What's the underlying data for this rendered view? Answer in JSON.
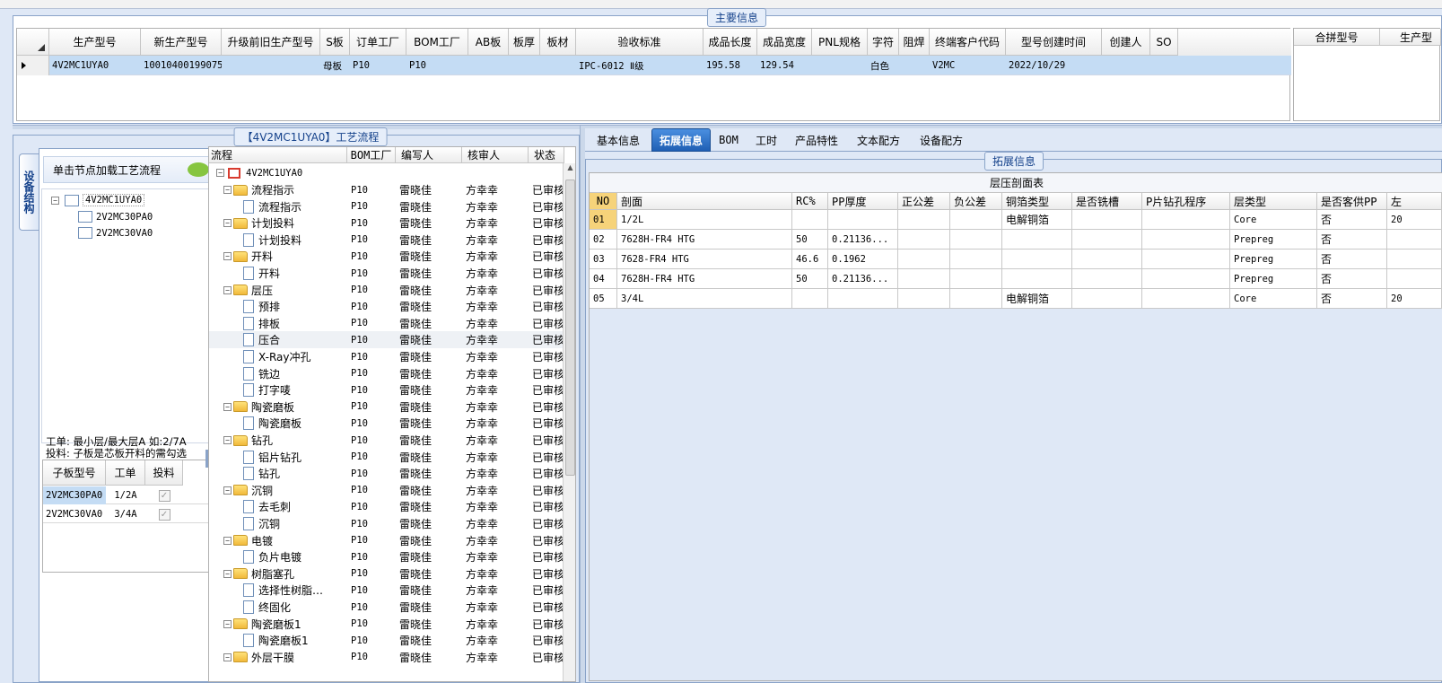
{
  "main_info": {
    "legend": "主要信息",
    "columns": [
      "生产型号",
      "新生产型号",
      "升级前旧生产型号",
      "S板",
      "订单工厂",
      "BOM工厂",
      "AB板",
      "板厚",
      "板材",
      "验收标准",
      "成品长度",
      "成品宽度",
      "PNL规格",
      "字符",
      "阻焊",
      "终端客户代码",
      "型号创建时间",
      "创建人",
      "SO"
    ],
    "row": [
      "4V2MC1UYA0",
      "10010400199075",
      "",
      "母板",
      "P10",
      "P10",
      "",
      "",
      "",
      "IPC-6012 Ⅱ级",
      "195.58",
      "129.54",
      "",
      "白色",
      "",
      "V2MC",
      "2022/10/29",
      "",
      ""
    ],
    "right_columns": [
      "合拼型号",
      "生产型"
    ]
  },
  "process": {
    "legend": "【4V2MC1UYA0】工艺流程",
    "side_tab": "设备结构",
    "load_hint": "单击节点加载工艺流程",
    "structure_tree": [
      "4V2MC1UYA0",
      "2V2MC30PA0",
      "2V2MC30VA0"
    ],
    "note_line1": "工单: 最小层/最大层A 如:2/7A",
    "note_line2": "投料: 子板是芯板开料的需勾选",
    "sub_columns": [
      "子板型号",
      "工单",
      "投料"
    ],
    "sub_rows": [
      {
        "model": "2V2MC30PA0",
        "order": "1/2A"
      },
      {
        "model": "2V2MC30VA0",
        "order": "3/4A"
      }
    ],
    "flow_columns": [
      "流程",
      "BOM工厂",
      "编写人",
      "核审人",
      "状态"
    ],
    "flow_root": "4V2MC1UYA0",
    "flow_rows": [
      {
        "name": "流程指示",
        "type": "folder",
        "bom": "P10",
        "writer": "雷晓佳",
        "checker": "方幸幸",
        "status": "已审核"
      },
      {
        "name": "流程指示",
        "type": "doc",
        "bom": "P10",
        "writer": "雷晓佳",
        "checker": "方幸幸",
        "status": "已审核"
      },
      {
        "name": "计划投料",
        "type": "folder",
        "bom": "P10",
        "writer": "雷晓佳",
        "checker": "方幸幸",
        "status": "已审核"
      },
      {
        "name": "计划投料",
        "type": "doc",
        "bom": "P10",
        "writer": "雷晓佳",
        "checker": "方幸幸",
        "status": "已审核"
      },
      {
        "name": "开料",
        "type": "folder",
        "bom": "P10",
        "writer": "雷晓佳",
        "checker": "方幸幸",
        "status": "已审核"
      },
      {
        "name": "开料",
        "type": "doc",
        "bom": "P10",
        "writer": "雷晓佳",
        "checker": "方幸幸",
        "status": "已审核"
      },
      {
        "name": "层压",
        "type": "folder",
        "bom": "P10",
        "writer": "雷晓佳",
        "checker": "方幸幸",
        "status": "已审核"
      },
      {
        "name": "预排",
        "type": "doc",
        "bom": "P10",
        "writer": "雷晓佳",
        "checker": "方幸幸",
        "status": "已审核"
      },
      {
        "name": "排板",
        "type": "doc",
        "bom": "P10",
        "writer": "雷晓佳",
        "checker": "方幸幸",
        "status": "已审核"
      },
      {
        "name": "压合",
        "type": "doc",
        "bom": "P10",
        "writer": "雷晓佳",
        "checker": "方幸幸",
        "status": "已审核"
      },
      {
        "name": "X-Ray冲孔",
        "type": "doc",
        "bom": "P10",
        "writer": "雷晓佳",
        "checker": "方幸幸",
        "status": "已审核"
      },
      {
        "name": "铣边",
        "type": "doc",
        "bom": "P10",
        "writer": "雷晓佳",
        "checker": "方幸幸",
        "status": "已审核"
      },
      {
        "name": "打字唛",
        "type": "doc",
        "bom": "P10",
        "writer": "雷晓佳",
        "checker": "方幸幸",
        "status": "已审核"
      },
      {
        "name": "陶瓷磨板",
        "type": "folder",
        "bom": "P10",
        "writer": "雷晓佳",
        "checker": "方幸幸",
        "status": "已审核"
      },
      {
        "name": "陶瓷磨板",
        "type": "doc",
        "bom": "P10",
        "writer": "雷晓佳",
        "checker": "方幸幸",
        "status": "已审核"
      },
      {
        "name": "钻孔",
        "type": "folder",
        "bom": "P10",
        "writer": "雷晓佳",
        "checker": "方幸幸",
        "status": "已审核"
      },
      {
        "name": "铝片钻孔",
        "type": "doc",
        "bom": "P10",
        "writer": "雷晓佳",
        "checker": "方幸幸",
        "status": "已审核"
      },
      {
        "name": "钻孔",
        "type": "doc",
        "bom": "P10",
        "writer": "雷晓佳",
        "checker": "方幸幸",
        "status": "已审核"
      },
      {
        "name": "沉铜",
        "type": "folder",
        "bom": "P10",
        "writer": "雷晓佳",
        "checker": "方幸幸",
        "status": "已审核"
      },
      {
        "name": "去毛刺",
        "type": "doc",
        "bom": "P10",
        "writer": "雷晓佳",
        "checker": "方幸幸",
        "status": "已审核"
      },
      {
        "name": "沉铜",
        "type": "doc",
        "bom": "P10",
        "writer": "雷晓佳",
        "checker": "方幸幸",
        "status": "已审核"
      },
      {
        "name": "电镀",
        "type": "folder",
        "bom": "P10",
        "writer": "雷晓佳",
        "checker": "方幸幸",
        "status": "已审核"
      },
      {
        "name": "负片电镀",
        "type": "doc",
        "bom": "P10",
        "writer": "雷晓佳",
        "checker": "方幸幸",
        "status": "已审核"
      },
      {
        "name": "树脂塞孔",
        "type": "folder",
        "bom": "P10",
        "writer": "雷晓佳",
        "checker": "方幸幸",
        "status": "已审核"
      },
      {
        "name": "选择性树脂…",
        "type": "doc",
        "bom": "P10",
        "writer": "雷晓佳",
        "checker": "方幸幸",
        "status": "已审核"
      },
      {
        "name": "终固化",
        "type": "doc",
        "bom": "P10",
        "writer": "雷晓佳",
        "checker": "方幸幸",
        "status": "已审核"
      },
      {
        "name": "陶瓷磨板1",
        "type": "folder",
        "bom": "P10",
        "writer": "雷晓佳",
        "checker": "方幸幸",
        "status": "已审核"
      },
      {
        "name": "陶瓷磨板1",
        "type": "doc",
        "bom": "P10",
        "writer": "雷晓佳",
        "checker": "方幸幸",
        "status": "已审核"
      },
      {
        "name": "外层干膜",
        "type": "folder",
        "bom": "P10",
        "writer": "雷晓佳",
        "checker": "方幸幸",
        "status": "已审核"
      }
    ]
  },
  "tabs": {
    "items": [
      "基本信息",
      "拓展信息",
      "BOM",
      "工时",
      "产品特性",
      "文本配方",
      "设备配方"
    ],
    "active": 1
  },
  "ext_info": {
    "legend": "拓展信息",
    "table_title": "层压剖面表",
    "columns": [
      "NO",
      "剖面",
      "RC%",
      "PP厚度",
      "正公差",
      "负公差",
      "铜箔类型",
      "是否铣槽",
      "P片钻孔程序",
      "层类型",
      "是否客供PP",
      "左"
    ],
    "rows": [
      {
        "no": "01",
        "section": "1/2L",
        "rc": "",
        "pp": "",
        "plus": "",
        "minus": "",
        "copper": "电解铜箔",
        "slot": "",
        "prog": "",
        "layer": "Core",
        "cust": "否",
        "left": "20"
      },
      {
        "no": "02",
        "section": "7628H-FR4 HTG",
        "rc": "50",
        "pp": "0.21136...",
        "plus": "",
        "minus": "",
        "copper": "",
        "slot": "",
        "prog": "",
        "layer": "Prepreg",
        "cust": "否",
        "left": ""
      },
      {
        "no": "03",
        "section": "7628-FR4 HTG",
        "rc": "46.6",
        "pp": "0.1962",
        "plus": "",
        "minus": "",
        "copper": "",
        "slot": "",
        "prog": "",
        "layer": "Prepreg",
        "cust": "否",
        "left": ""
      },
      {
        "no": "04",
        "section": "7628H-FR4 HTG",
        "rc": "50",
        "pp": "0.21136...",
        "plus": "",
        "minus": "",
        "copper": "",
        "slot": "",
        "prog": "",
        "layer": "Prepreg",
        "cust": "否",
        "left": ""
      },
      {
        "no": "05",
        "section": "3/4L",
        "rc": "",
        "pp": "",
        "plus": "",
        "minus": "",
        "copper": "电解铜箔",
        "slot": "",
        "prog": "",
        "layer": "Core",
        "cust": "否",
        "left": "20"
      }
    ]
  },
  "colors": {
    "background": "#dfe8f6",
    "selected_row": "#c4dcf4",
    "accent": "#15428b",
    "active_tab": "#2b6fc6",
    "grid_line": "#b0b0b0"
  }
}
